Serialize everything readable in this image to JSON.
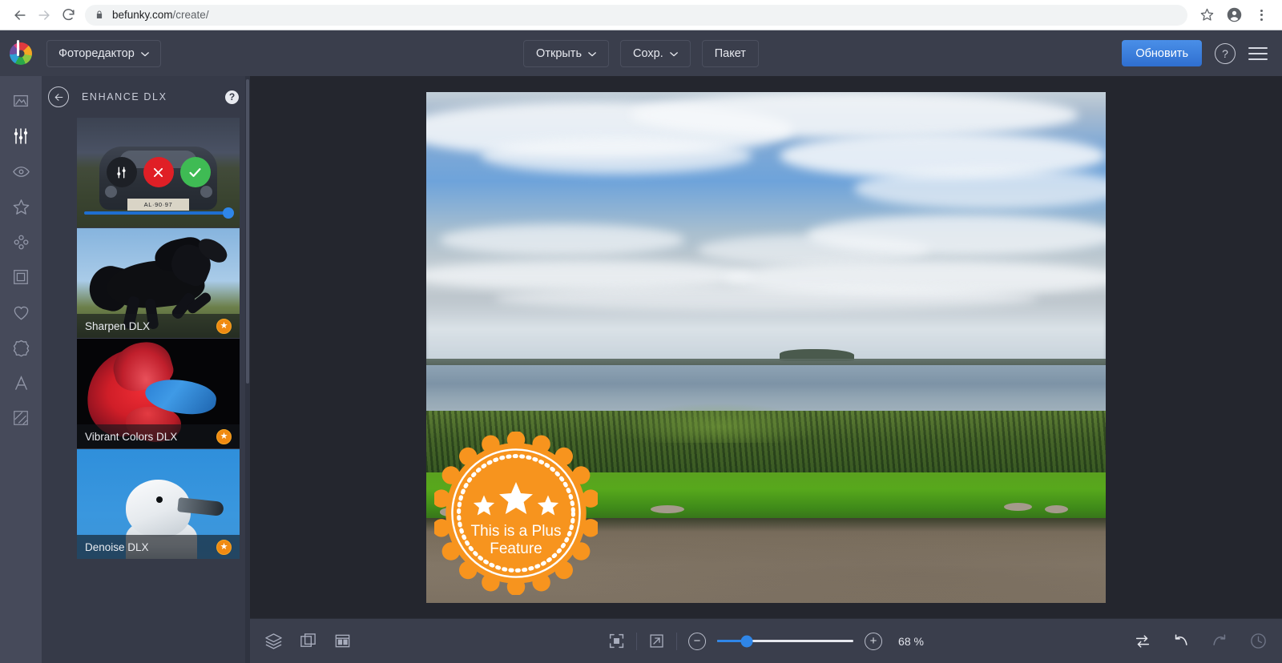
{
  "browser": {
    "url_domain": "befunky.com",
    "url_path": "/create/",
    "back_icon": "back-arrow-icon",
    "forward_icon": "forward-arrow-icon",
    "reload_icon": "reload-icon",
    "lock_icon": "lock-icon",
    "bookmark_icon": "bookmark-star-icon",
    "profile_icon": "profile-avatar-icon",
    "menu_icon": "three-dot-menu-icon"
  },
  "header": {
    "logo": "befunky-logo",
    "mode_label": "Фоторедактор",
    "mode_chevron": "chevron-down-icon",
    "actions": [
      {
        "label": "Открыть",
        "has_chevron": true
      },
      {
        "label": "Сохр.",
        "has_chevron": true
      },
      {
        "label": "Пакет",
        "has_chevron": false
      }
    ],
    "upgrade_label": "Обновить",
    "help_label": "?",
    "menu_icon": "hamburger-menu-icon"
  },
  "rail": {
    "items": [
      {
        "icon": "image-icon",
        "active": false
      },
      {
        "icon": "sliders-icon",
        "active": true
      },
      {
        "icon": "eye-icon",
        "active": false
      },
      {
        "icon": "star-icon",
        "active": false
      },
      {
        "icon": "graphics-dots-icon",
        "active": false
      },
      {
        "icon": "frame-icon",
        "active": false
      },
      {
        "icon": "heart-icon",
        "active": false
      },
      {
        "icon": "badge-rosette-icon",
        "active": false
      },
      {
        "icon": "text-a-icon",
        "active": false
      },
      {
        "icon": "texture-icon",
        "active": false
      }
    ]
  },
  "panel": {
    "back_icon": "back-arrow-circle-icon",
    "title": "ENHANCE DLX",
    "help_label": "?",
    "items": [
      {
        "label": "",
        "thumb": "car-photo",
        "active": true,
        "is_plus": false,
        "tools": [
          {
            "icon": "sliders-icon",
            "name": "settings"
          },
          {
            "icon": "close-x-icon",
            "name": "cancel"
          },
          {
            "icon": "checkmark-icon",
            "name": "apply"
          }
        ],
        "plate_text": "AL·90·97",
        "slider_value": 97
      },
      {
        "label": "Sharpen DLX",
        "thumb": "horse-photo",
        "active": false,
        "is_plus": true,
        "badge_icon": "star-badge-icon"
      },
      {
        "label": "Vibrant Colors DLX",
        "thumb": "betta-fish-photo",
        "active": false,
        "is_plus": true,
        "badge_icon": "star-badge-icon"
      },
      {
        "label": "Denoise DLX",
        "thumb": "seagull-photo",
        "active": false,
        "is_plus": true,
        "badge_icon": "star-badge-icon"
      }
    ]
  },
  "canvas": {
    "photo_description": "lakeside-landscape-photo",
    "plus_badge": {
      "line1": "This is a Plus",
      "line2": "Feature",
      "stars": 3,
      "color": "#f7941e"
    }
  },
  "bottom_bar": {
    "left_tools": [
      {
        "icon": "layers-icon"
      },
      {
        "icon": "crop-transform-icon"
      },
      {
        "icon": "template-grid-icon"
      }
    ],
    "fit_icon": "fit-to-screen-icon",
    "fullscreen_icon": "expand-arrow-icon",
    "zoom_out_label": "−",
    "zoom_in_label": "+",
    "zoom_value": "68 %",
    "zoom_percent": 22,
    "right_tools": [
      {
        "icon": "compare-toggle-icon",
        "enabled": true
      },
      {
        "icon": "undo-icon",
        "enabled": true
      },
      {
        "icon": "redo-icon",
        "enabled": false
      },
      {
        "icon": "history-clock-icon",
        "enabled": false
      }
    ]
  },
  "colors": {
    "accent_blue": "#2f86e8",
    "plus_orange": "#f7941e",
    "header_bg": "#3a3e4c",
    "panel_bg": "#363a48",
    "canvas_bg": "#24262e"
  }
}
